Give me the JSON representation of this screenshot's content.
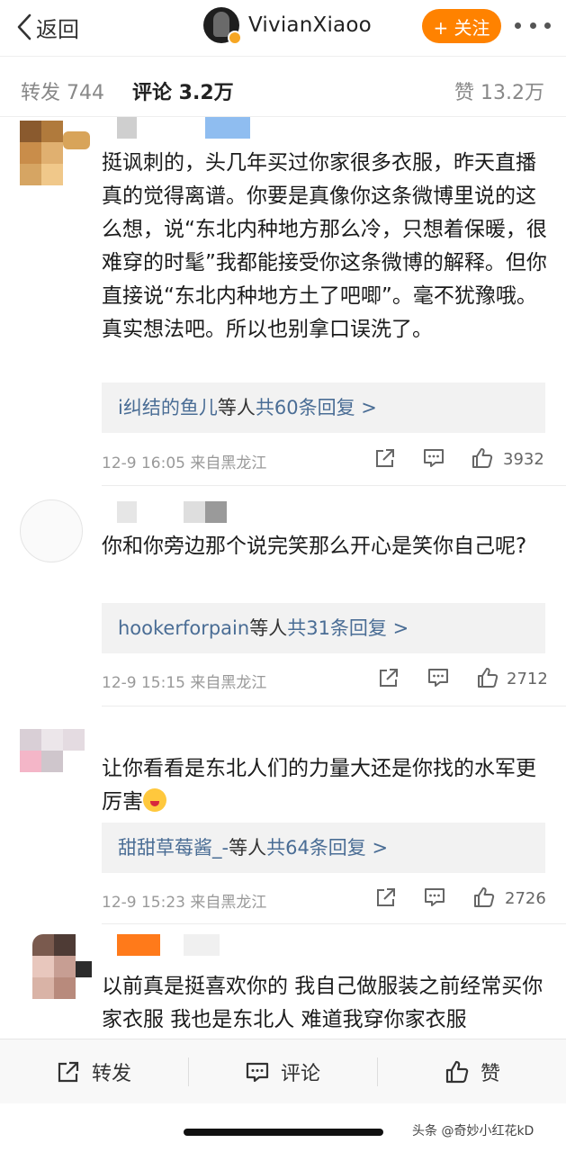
{
  "header": {
    "back_label": "返回",
    "username": "VivianXiaoo",
    "follow_label": "+ 关注"
  },
  "tabs": {
    "repost": "转发 744",
    "comment": "评论 3.2万",
    "like": "赞 13.2万"
  },
  "comments": [
    {
      "text": "挺讽刺的，头几年买过你家很多衣服，昨天直播真的觉得离谱。你要是真像你这条微博里说的这么想，说“东北内种地方那么冷，只想着保暖，很难穿的时髦”我都能接受你这条微博的解释。但你直接说“东北内种地方土了吧唧”。毫不犹豫哦。真实想法吧。所以也别拿口误洗了。",
      "reply_name": "i纠结的鱼儿",
      "reply_mid": "等人",
      "reply_count": "共60条回复 >",
      "time": "12-9 16:05  来自黑龙江",
      "likes": "3932"
    },
    {
      "text": "你和你旁边那个说完笑那么开心是笑你自己呢?",
      "reply_name": "hookerforpain",
      "reply_mid": "等人",
      "reply_count": "共31条回复 >",
      "time": "12-9 15:15  来自黑龙江",
      "likes": "2712"
    },
    {
      "text": "让你看看是东北人们的力量大还是你找的水军更厉害",
      "reply_name": "甜甜草莓酱_-",
      "reply_mid": "等人",
      "reply_count": "共64条回复 >",
      "time": "12-9 15:23  来自黑龙江",
      "likes": "2726"
    },
    {
      "text": "以前真是挺喜欢你的 我自己做服装之前经常买你家衣服 我也是东北人 难道我穿你家衣服"
    }
  ],
  "bottom_bar": {
    "repost": "转发",
    "comment": "评论",
    "like": "赞"
  },
  "watermark": "头条 @奇妙小红花kD",
  "icons": {
    "back": "chevron-left-icon",
    "more": "more-dots-icon",
    "share": "share-icon",
    "reply": "comment-icon",
    "like": "thumbs-up-icon"
  },
  "colors": {
    "accent_orange": "#ff8200",
    "link_blue": "#4a6d95",
    "reply_bg": "#f2f2f2"
  }
}
